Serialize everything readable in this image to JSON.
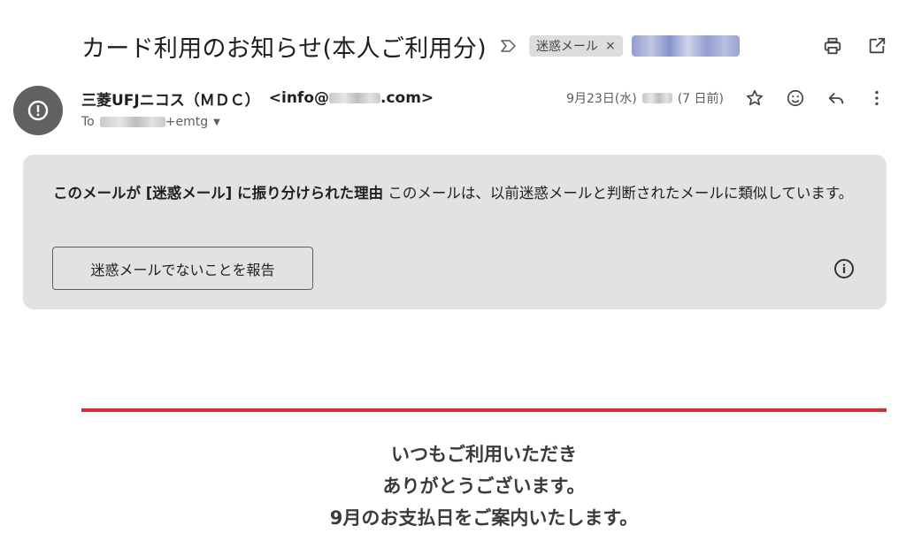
{
  "subject": {
    "title": "カード利用のお知らせ(本人ご利用分)",
    "labels": [
      {
        "text": "迷惑メール",
        "close": "×"
      }
    ]
  },
  "sender": {
    "name": "三菱UFJニコス（ＭＤＣ）",
    "email_prefix": "<info@",
    "email_suffix": ".com>",
    "date_prefix": "9月23日(水)",
    "date_suffix": "(7 日前)",
    "to_prefix": "To",
    "to_suffix": "+emtg"
  },
  "spam_banner": {
    "reason_title": "このメールが [迷惑メール] に振り分けられた理由",
    "reason_text": " このメールは、以前迷惑メールと判断されたメールに類似しています。",
    "report_button": "迷惑メールでないことを報告"
  },
  "email_body": {
    "lines": [
      "いつもご利用いただき",
      "ありがとうございます。",
      "9月のお支払日をご案内いたします。"
    ]
  },
  "colors": {
    "accent_red": "#dd2b32",
    "banner_bg": "#e2e2e2",
    "avatar_bg": "#616161"
  },
  "icons": [
    "label-arrow-icon",
    "print-icon",
    "open-in-new-icon",
    "spam-alert-icon",
    "star-icon",
    "emoji-icon",
    "reply-icon",
    "more-vert-icon",
    "info-icon",
    "chevron-down-icon"
  ]
}
